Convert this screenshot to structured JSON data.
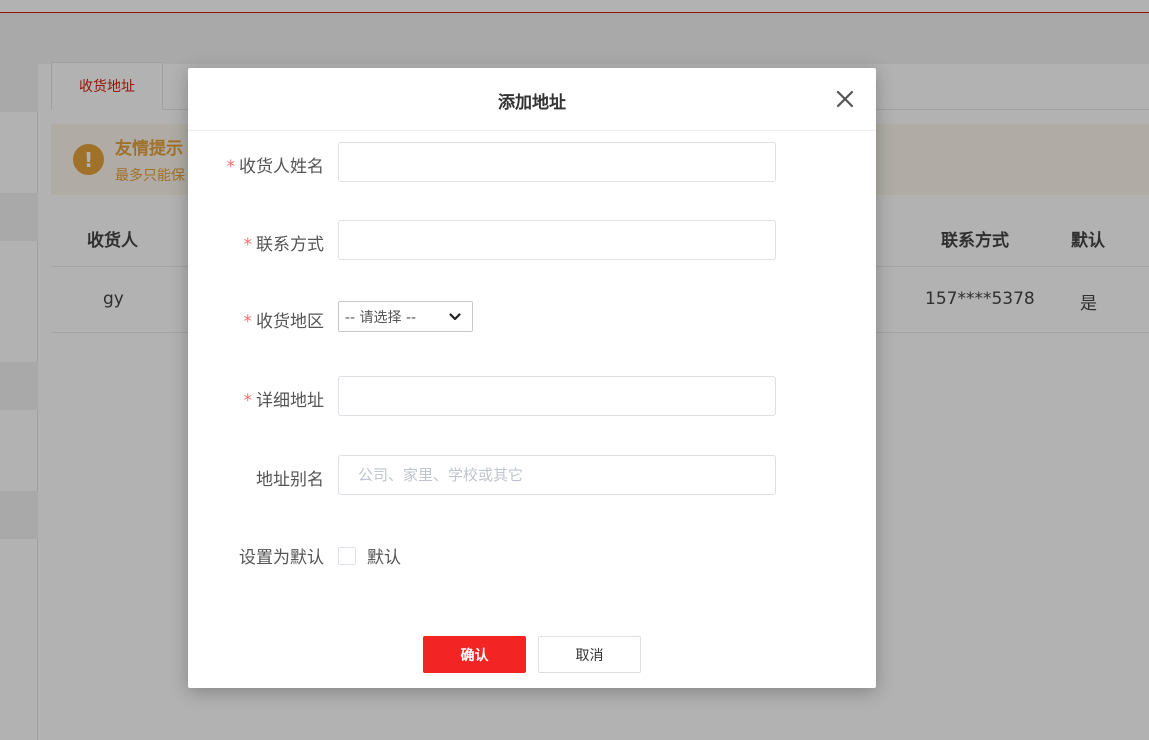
{
  "background": {
    "tab_label": "收货地址",
    "notice": {
      "title": "友情提示",
      "text": "最多只能保"
    },
    "table": {
      "headers": [
        "收货人",
        "联系方式",
        "默认"
      ],
      "row": {
        "name": "gy",
        "phone": "157****5378",
        "default": "是"
      }
    }
  },
  "modal": {
    "title": "添加地址",
    "close_icon": "close-icon",
    "fields": {
      "name": {
        "label": "收货人姓名",
        "required_mark": "*",
        "value": ""
      },
      "phone": {
        "label": "联系方式",
        "required_mark": "*",
        "value": ""
      },
      "region": {
        "label": "收货地区",
        "required_mark": "*",
        "selected": "-- 请选择 --"
      },
      "detail": {
        "label": "详细地址",
        "required_mark": "*",
        "value": ""
      },
      "alias": {
        "label": "地址别名",
        "placeholder": "公司、家里、学校或其它",
        "value": ""
      },
      "default": {
        "label": "设置为默认",
        "checkbox_label": "默认",
        "checked": false
      }
    },
    "buttons": {
      "confirm": "确认",
      "cancel": "取消"
    }
  },
  "colors": {
    "accent": "#f22424",
    "brand_red": "#d81e06",
    "required": "#f56c6c",
    "notice": "#e6a23c"
  }
}
